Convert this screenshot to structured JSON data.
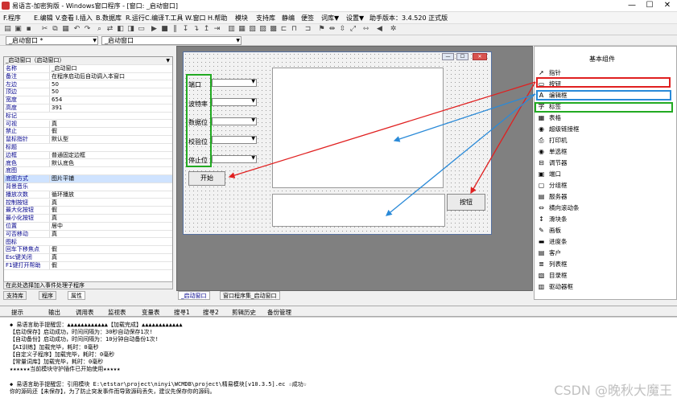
{
  "window": {
    "title": "易语言-加密狗版 - Windows窗口程序 - [窗口: _启动窗口]",
    "min": "—",
    "max": "☐",
    "close": "✕"
  },
  "menu": [
    "F.程序",
    "E.编辑",
    "V.查看",
    "I.插入",
    "B.数据库",
    "R.运行",
    "C.编译",
    "T.工具",
    "W.窗口",
    "H.帮助",
    "模块",
    "支持库",
    "静编",
    "便签",
    "词库▼",
    "设置▼",
    "助手版本：3.4.520 正式版"
  ],
  "toolbar_icons": [
    "new-icon",
    "open-icon",
    "save-icon",
    "cut-icon",
    "copy-icon",
    "paste-icon",
    "undo-icon",
    "redo-icon",
    "find-icon",
    "run-icon",
    "stop-icon",
    "pause-icon",
    "step-icon",
    "compile-icon",
    "grid-icon",
    "align-icon",
    "settings-icon"
  ],
  "combos": {
    "window_select": "_启动窗口 *",
    "component_select": "_启动窗口"
  },
  "prop_panel": {
    "header": "_启动窗口（启动窗口）",
    "rows": [
      {
        "name": "名称",
        "value": "_启动窗口"
      },
      {
        "name": "备注",
        "value": "在程序启动后自动调入本窗口"
      },
      {
        "name": "左边",
        "value": "50"
      },
      {
        "name": "顶边",
        "value": "50"
      },
      {
        "name": "宽度",
        "value": "654"
      },
      {
        "name": "高度",
        "value": "391"
      },
      {
        "name": "标记",
        "value": ""
      },
      {
        "name": "可视",
        "value": "真"
      },
      {
        "name": "禁止",
        "value": "假"
      },
      {
        "name": "鼠标指针",
        "value": "默认型"
      },
      {
        "name": "标题",
        "value": ""
      },
      {
        "name": "边框",
        "value": "普通固定边框"
      },
      {
        "name": "底色",
        "value": "默认底色"
      },
      {
        "name": "底图",
        "value": ""
      },
      {
        "name": "底图方式",
        "value": "图片平铺"
      },
      {
        "name": "背景音乐",
        "value": ""
      },
      {
        "name": "播放次数",
        "value": "循环播放"
      },
      {
        "name": "控制按钮",
        "value": "真"
      },
      {
        "name": "最大化按钮",
        "value": "假"
      },
      {
        "name": "最小化按钮",
        "value": "真"
      },
      {
        "name": "位置",
        "value": "居中"
      },
      {
        "name": "可否移动",
        "value": "真"
      },
      {
        "name": "图标",
        "value": ""
      },
      {
        "name": "回车下移焦点",
        "value": "假"
      },
      {
        "name": "Esc键关闭",
        "value": "真"
      },
      {
        "name": "F1键打开帮助",
        "value": "假"
      }
    ],
    "status": "在此处选择加入事件处理子程序"
  },
  "left_tabs": [
    "支持库",
    "程序",
    "属性"
  ],
  "form": {
    "labels": [
      "端口",
      "波特率",
      "数据位",
      "校验位",
      "停止位"
    ],
    "start_button": "开始",
    "send_button": "按钮"
  },
  "bottom_tabs": [
    "_启动窗口",
    "窗口程序集_启动窗口"
  ],
  "components": {
    "title": "基本组件",
    "items": [
      {
        "icon": "pointer-icon",
        "glyph": "➚",
        "label": "指针"
      },
      {
        "icon": "button-icon",
        "glyph": "▭",
        "label": "按钮"
      },
      {
        "icon": "editbox-icon",
        "glyph": "A",
        "label": "编辑框"
      },
      {
        "icon": "label-icon",
        "glyph": "字",
        "label": "标签"
      },
      {
        "icon": "table-icon",
        "glyph": "▦",
        "label": "表格"
      },
      {
        "icon": "hyperlink-icon",
        "glyph": "◉",
        "label": "超级链接框"
      },
      {
        "icon": "printer-icon",
        "glyph": "⎙",
        "label": "打印机"
      },
      {
        "icon": "radio-icon",
        "glyph": "◉",
        "label": "单选框"
      },
      {
        "icon": "slider-icon",
        "glyph": "⊟",
        "label": "调节器"
      },
      {
        "icon": "port-icon",
        "glyph": "▣",
        "label": "端口"
      },
      {
        "icon": "groupbox-icon",
        "glyph": "▢",
        "label": "分组框"
      },
      {
        "icon": "server-icon",
        "glyph": "▤",
        "label": "服务器"
      },
      {
        "icon": "hscroll-icon",
        "glyph": "⇔",
        "label": "横向滚动条"
      },
      {
        "icon": "scrollbar-icon",
        "glyph": "↕",
        "label": "滑块条"
      },
      {
        "icon": "canvas-icon",
        "glyph": "✎",
        "label": "画板"
      },
      {
        "icon": "progress-icon",
        "glyph": "▬",
        "label": "进度条"
      },
      {
        "icon": "client-icon",
        "glyph": "▤",
        "label": "客户"
      },
      {
        "icon": "listbox-icon",
        "glyph": "≣",
        "label": "列表框"
      },
      {
        "icon": "dirbox-icon",
        "glyph": "▧",
        "label": "目录框"
      },
      {
        "icon": "drivebox-icon",
        "glyph": "▥",
        "label": "驱动器框"
      }
    ]
  },
  "output_tabs": [
    "提示",
    "输出",
    "调用表",
    "监视表",
    "变量表",
    "搜寻1",
    "搜寻2",
    "剪辑历史",
    "备份管理"
  ],
  "output_lines": [
    "◆ 易语言助手提醒您：▲▲▲▲▲▲▲▲▲▲▲▲【加载完成】▲▲▲▲▲▲▲▲▲▲▲▲",
    "【启动保存】启动成功，时间间隔为：30秒自动保存1次!",
    "【自动备份】启动成功，时间间隔为：10分钟自动备份1次!",
    "【AI训练】加载完毕，耗时：0毫秒",
    "【自定义子程序】加载完毕，耗时：0毫秒",
    "【常量词库】加载完毕，耗时：0毫秒",
    "★★★★★★当前模块守护插件已开始使用★★★★★",
    "",
    "◆ 易语言助手提醒您：引用模块 E:\\etstar\\project\\ninyi\\WCMDB\\project\\精易模块[v10.3.5].ec ☆成功☆",
    "你的源码还【未保存】，为了防止突发事件而导致源码丢失，建议先保存你的源码。"
  ],
  "watermark": "CSDN @晚秋大魔王",
  "colors": {
    "red": "#e02020",
    "blue": "#2a8ad8",
    "green": "#22aa22"
  }
}
